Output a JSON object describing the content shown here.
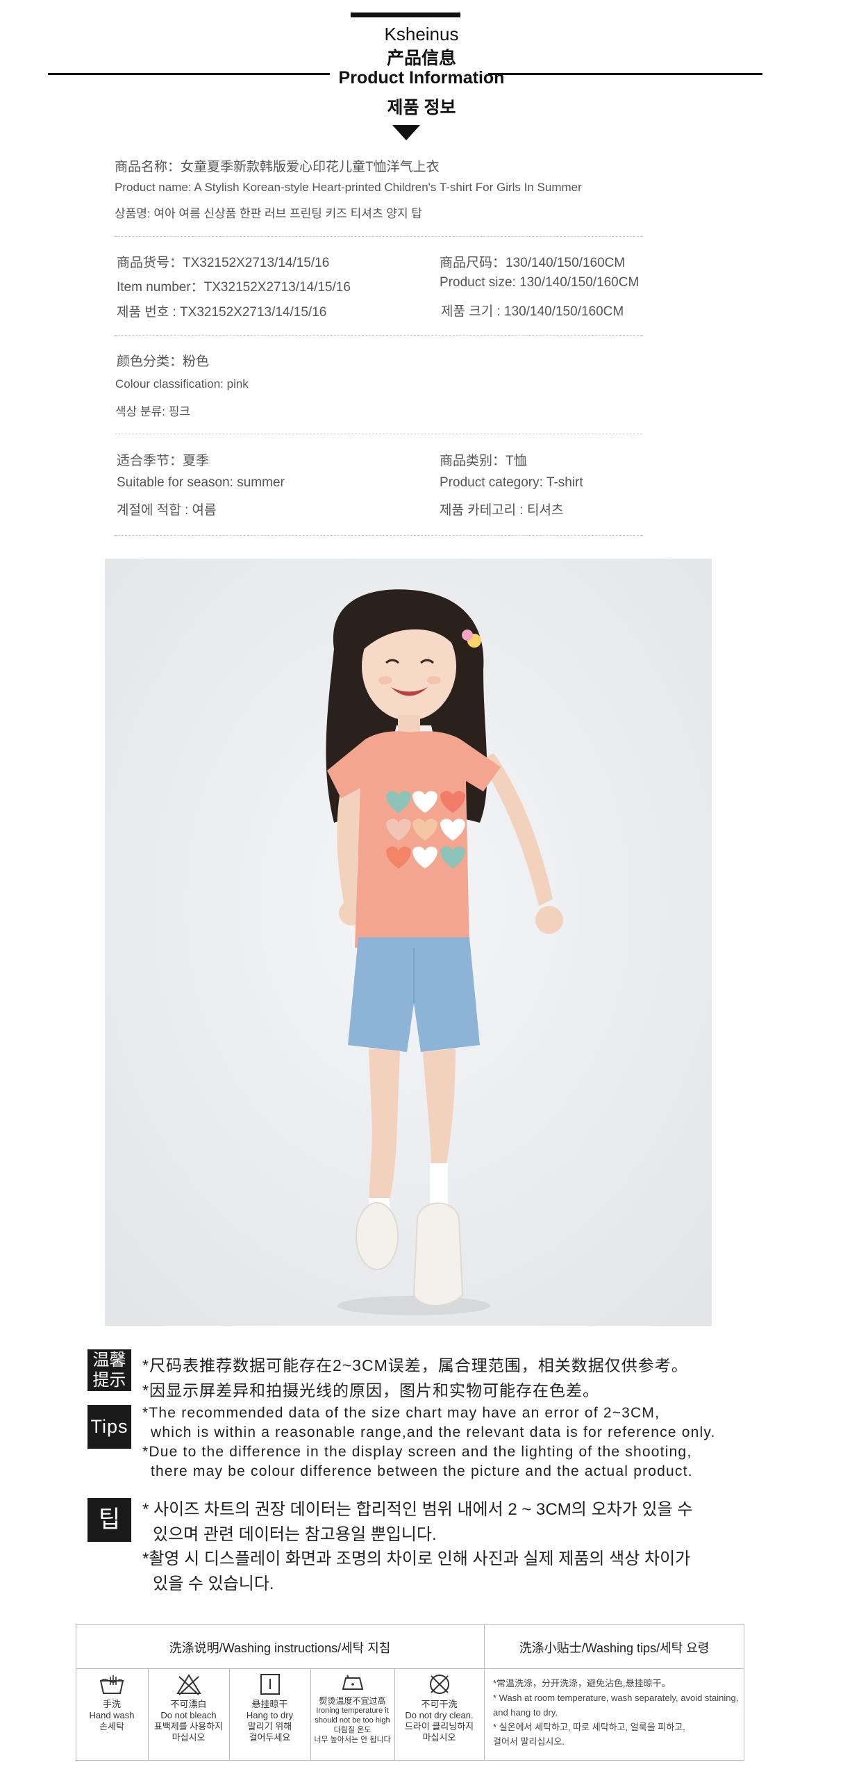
{
  "header": {
    "brand": "Ksheinus",
    "title_zh": "产品信息",
    "title_en": "Product Information",
    "title_ko": "제품 정보"
  },
  "product": {
    "name_zh": "商品名称：女童夏季新款韩版爱心印花儿童T恤洋气上衣",
    "name_en": "Product name: A Stylish Korean-style Heart-printed Children's T-shirt For Girls In Summer",
    "name_ko": "상품명: 여아 여름 신상품 한판 러브 프린팅 키즈 티셔츠 양지 탑",
    "item_zh": "商品货号：TX32152X2713/14/15/16",
    "item_en": "Item number：TX32152X2713/14/15/16",
    "item_ko": "제품 번호 : TX32152X2713/14/15/16",
    "size_zh": "商品尺码：130/140/150/160CM",
    "size_en": "Product size: 130/140/150/160CM",
    "size_ko": "제품 크기 : 130/140/150/160CM",
    "color_zh": "颜色分类：粉色",
    "color_en": "Colour classification: pink",
    "color_ko": "색상 분류: 핑크",
    "season_zh": "适合季节：夏季",
    "season_en": "Suitable for season: summer",
    "season_ko": "계절에 적합 : 여름",
    "category_zh": "商品类别：T恤",
    "category_en": "Product category: T-shirt",
    "category_ko": "제품 카테고리 : 티셔츠"
  },
  "tips": {
    "badge_zh_1": "温馨",
    "badge_zh_2": "提示",
    "zh_1": "*尺码表推荐数据可能存在2~3CM误差，属合理范围，相关数据仅供参考。",
    "zh_2": "*因显示屏差异和拍摄光线的原因，图片和实物可能存在色差。",
    "badge_en": "Tips",
    "en_1": "*The recommended data of the size chart may have an error of 2~3CM,",
    "en_2": "which is within a reasonable range,and the relevant data is for reference only.",
    "en_3": "*Due to the difference in the display screen and the lighting of the shooting,",
    "en_4": "there may be colour difference between the picture and the actual product.",
    "badge_ko": "팁",
    "ko_1": "* 사이즈 차트의 권장 데이터는 합리적인 범위 내에서 2 ~ 3CM의 오차가 있을 수",
    "ko_2": "있으며 관련 데이터는 참고용일 뿐입니다.",
    "ko_3": "*촬영 시 디스플레이 화면과 조명의 차이로 인해 사진과 실제 제품의 색상 차이가",
    "ko_4": "있을 수 있습니다."
  },
  "washing": {
    "header_instructions": "洗涤说明/Washing instructions/세탁 지침",
    "header_tips": "洗涤小贴士/Washing tips/세탁 요령",
    "icons": [
      {
        "icon": "hand-wash-icon",
        "zh": "手洗",
        "en": "Hand wash",
        "ko": "손세탁"
      },
      {
        "icon": "no-bleach-icon",
        "zh": "不可漂白",
        "en": "Do not bleach",
        "ko": "표백제를 사용하지",
        "ko2": "마십시오"
      },
      {
        "icon": "hang-dry-icon",
        "zh": "悬挂晾干",
        "en": "Hang to dry",
        "ko": "말리기 위해",
        "ko2": "걸어두세요"
      },
      {
        "icon": "iron-low-icon",
        "zh": "熨烫温度不宜过高",
        "en": "Ironing temperature it",
        "en2": "should not be too high",
        "ko": "다림질 온도",
        "ko2": "너무 높아서는 안 됩니다"
      },
      {
        "icon": "no-dry-clean-icon",
        "zh": "不可干洗",
        "en": "Do not dry clean.",
        "ko": "드라이 클리닝하지",
        "ko2": "마십시오"
      }
    ],
    "tips": [
      "*常温洗涤，分开洗涤，避免沾色,悬挂晾干。",
      "* Wash at room temperature, wash separately, avoid staining,",
      "and hang to dry.",
      "* 실온에서 세탁하고, 따로 세탁하고, 얼룩을 피하고,",
      "걸어서 말리십시오."
    ]
  },
  "colors": {
    "tshirt": "#f4a590",
    "shorts": "#8db4d6",
    "background": "#eceef1"
  }
}
